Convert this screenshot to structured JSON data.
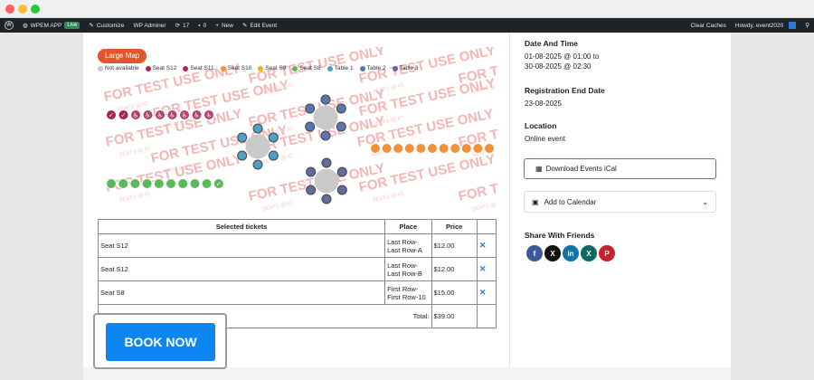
{
  "admin_bar": {
    "site_name": "WPEM APP",
    "live_badge": "Live",
    "customize": "Customize",
    "adminer": "WP Adminer",
    "updates_count": "17",
    "comments_count": "0",
    "new": "New",
    "edit_event": "Edit Event",
    "clear_caches": "Clear Caches",
    "howdy": "Howdy, event2020"
  },
  "map": {
    "large_map_label": "Large Map",
    "watermark": "FOR TEST USE ONLY",
    "watermark_small": "SEATS @ IO",
    "legend": [
      {
        "label": "Not available",
        "color": "#c8c8c8"
      },
      {
        "label": "Seat S12",
        "color": "#a4264b"
      },
      {
        "label": "Seat S11",
        "color": "#c02050"
      },
      {
        "label": "Seat S10",
        "color": "#f0913c"
      },
      {
        "label": "Seat S9",
        "color": "#f1b400"
      },
      {
        "label": "Seat S8",
        "color": "#5cb85c"
      },
      {
        "label": "Table 1",
        "color": "#4da0c8"
      },
      {
        "label": "Table 2",
        "color": "#5876b0"
      },
      {
        "label": "Table 3",
        "color": "#626a9e"
      }
    ]
  },
  "tickets": {
    "headers": {
      "name": "Selected tickets",
      "place": "Place",
      "price": "Price"
    },
    "rows": [
      {
        "name": "Seat S12",
        "place1": "Last Row-",
        "place2": "Last Row-A",
        "price": "$12.00",
        "remove": "✕"
      },
      {
        "name": "Seat S12",
        "place1": "Last Row-",
        "place2": "Last Row-B",
        "price": "$12.00",
        "remove": "✕"
      },
      {
        "name": "Seat S8",
        "place1": "First Row-",
        "place2": "First Row-10",
        "price": "$15.00",
        "remove": "✕"
      }
    ],
    "total_label": "Total:",
    "total_value": "$39.00"
  },
  "book_now": "BOOK NOW",
  "sidebar": {
    "date_heading": "Date And Time",
    "date_from": "01-08-2025 @ 01:00 to",
    "date_to": "30-08-2025 @ 02:30",
    "reg_heading": "Registration End Date",
    "reg_date": "23-08-2025",
    "location_heading": "Location",
    "location": "Online event",
    "ical_label": "Download Events iCal",
    "add_calendar": "Add to Calendar",
    "share_heading": "Share With Friends",
    "social": [
      {
        "name": "facebook",
        "glyph": "f",
        "color": "#3b5998"
      },
      {
        "name": "x",
        "glyph": "X",
        "color": "#111111"
      },
      {
        "name": "linkedin",
        "glyph": "in",
        "color": "#0e76a8"
      },
      {
        "name": "xing",
        "glyph": "X",
        "color": "#0a6b63"
      },
      {
        "name": "pinterest",
        "glyph": "P",
        "color": "#c8232c"
      }
    ]
  }
}
